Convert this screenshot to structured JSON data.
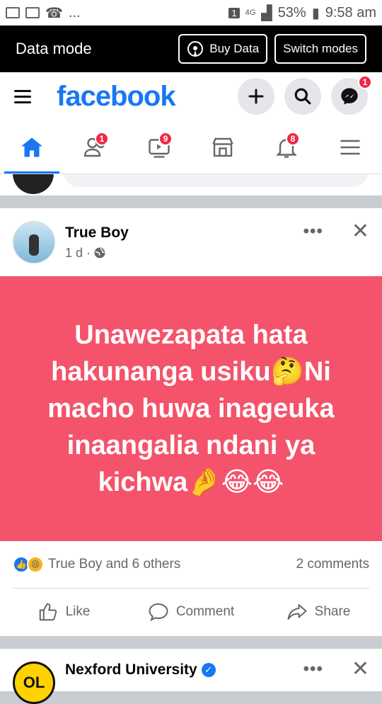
{
  "statusbar": {
    "dots": "...",
    "sim": "1",
    "network": "4G",
    "battery": "53%",
    "time": "9:58 am"
  },
  "datamode": {
    "title": "Data mode",
    "buy_label": "Buy Data",
    "switch_label": "Switch modes"
  },
  "header": {
    "logo": "facebook",
    "messenger_badge": "1"
  },
  "nav": {
    "friends_badge": "1",
    "watch_badge": "9",
    "notifications_badge": "8"
  },
  "post": {
    "author": "True Boy",
    "time": "1 d ·",
    "more": "•••",
    "close": "✕",
    "text": "Unawezapata hata hakunanga usiku🤔Ni macho huwa inageuka inaangalia ndani ya kichwa🤌😂😂",
    "reactions_text": "True Boy and 6 others",
    "comments_text": "2 comments",
    "like_label": "Like",
    "comment_label": "Comment",
    "share_label": "Share",
    "bg_color": "#f4536b"
  },
  "next_post": {
    "avatar_text": "OL",
    "author": "Nexford University",
    "more": "•••",
    "close": "✕"
  }
}
